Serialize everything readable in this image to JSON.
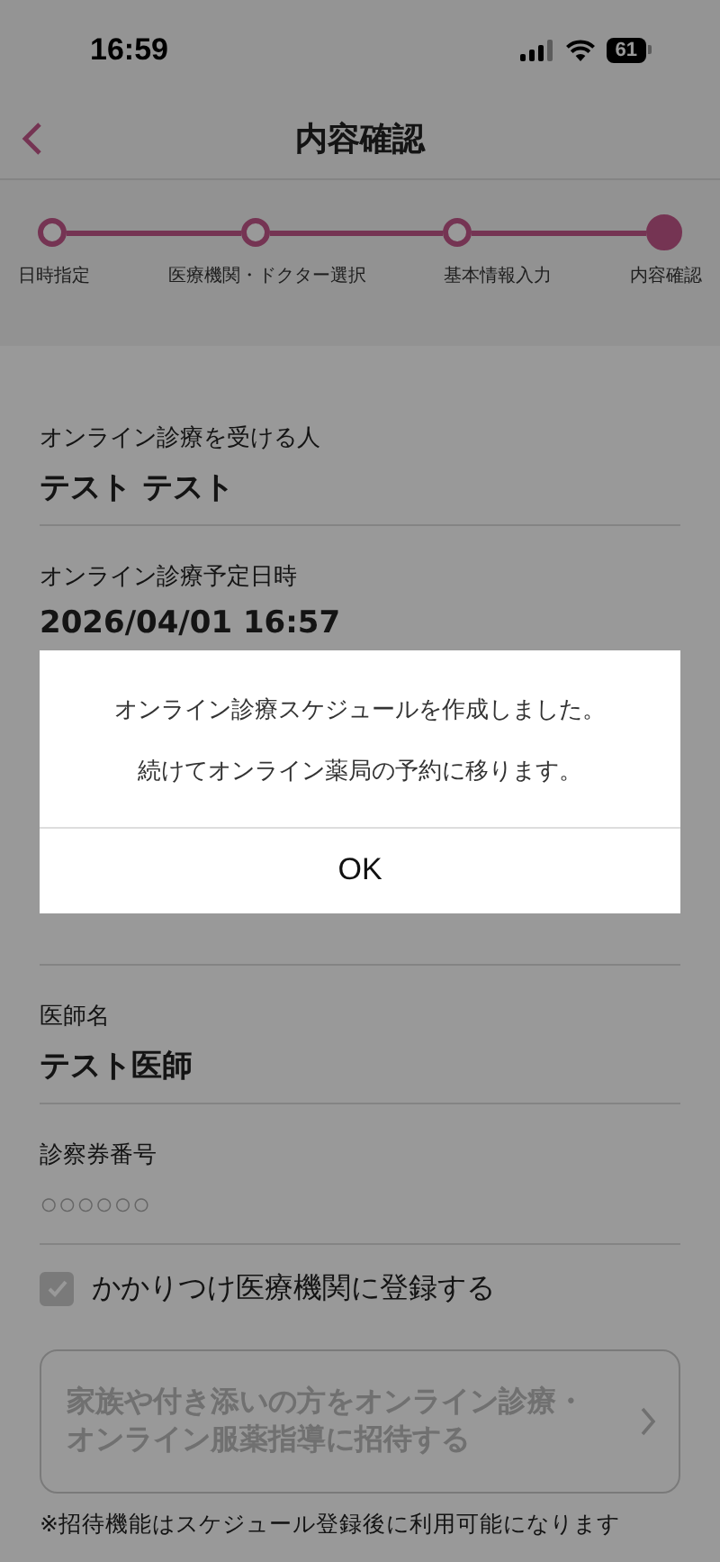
{
  "status_bar": {
    "time": "16:59",
    "battery": "61"
  },
  "header": {
    "title": "内容確認"
  },
  "steps": [
    {
      "label": "日時指定",
      "selected": false
    },
    {
      "label": "医療機関・ドクター選択",
      "selected": false
    },
    {
      "label": "基本情報入力",
      "selected": false
    },
    {
      "label": "内容確認",
      "selected": true
    }
  ],
  "fields_top": [
    {
      "label": "オンライン診療を受ける人",
      "value": "テスト テスト"
    },
    {
      "label": "オンライン診療予定日時",
      "value": "2026/04/01 16:57"
    }
  ],
  "fields_bottom": [
    {
      "label": "医師名",
      "value": "テスト医師"
    },
    {
      "label": "診察券番号",
      "placeholder": "○○○○○○"
    }
  ],
  "favorite_checkbox": {
    "label": "かかりつけ医療機関に登録する",
    "checked": true,
    "disabled": true
  },
  "invite_button": {
    "label": "家族や付き添いの方をオンライン診療・オンライン服薬指導に招待する",
    "disabled": true
  },
  "note": "※招待機能はスケジュール登録後に利用可能になります",
  "dialog": {
    "messages": [
      "オンライン診療スケジュールを作成しました。",
      "続けてオンライン薬局の予約に移ります。"
    ],
    "button": "OK"
  }
}
